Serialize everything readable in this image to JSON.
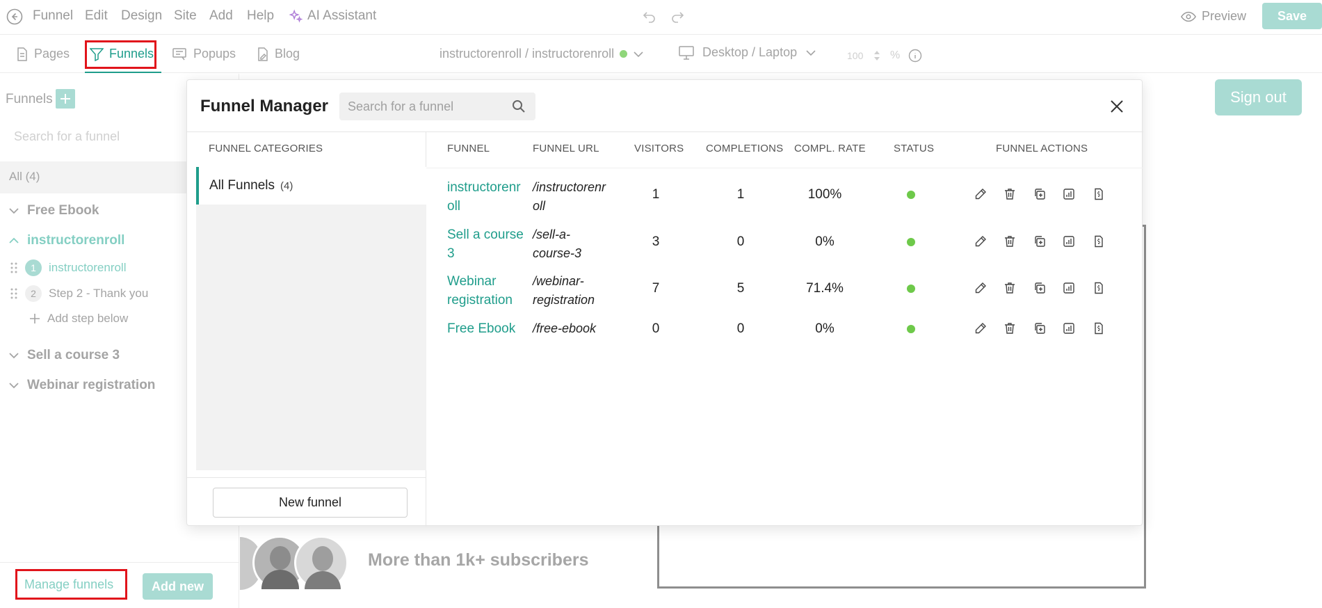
{
  "menu": {
    "items": [
      "Funnel",
      "Edit",
      "Design",
      "Site",
      "Add",
      "Help"
    ],
    "ai_assistant": "AI Assistant",
    "preview": "Preview",
    "save": "Save"
  },
  "tabs": {
    "pages": "Pages",
    "funnels": "Funnels",
    "popups": "Popups",
    "blog": "Blog"
  },
  "context": {
    "site_path": "instructorenroll / instructorenroll",
    "device": "Desktop / Laptop",
    "zoom_value": "100",
    "zoom_unit": "%"
  },
  "left_panel": {
    "title": "Funnels",
    "search_placeholder": "Search for a funnel",
    "all_filter": "All (4)",
    "groups": [
      {
        "name": "Free Ebook"
      },
      {
        "name": "instructorenroll"
      },
      {
        "name": "Sell a course 3"
      },
      {
        "name": "Webinar registration"
      }
    ],
    "steps": [
      {
        "num": "1",
        "label": "instructorenroll"
      },
      {
        "num": "2",
        "label": "Step 2 - Thank you"
      }
    ],
    "add_step": "Add step below",
    "manage_funnels": "Manage funnels",
    "add_new": "Add new"
  },
  "modal": {
    "title": "Funnel Manager",
    "search_placeholder": "Search for a funnel",
    "categories_header": "FUNNEL CATEGORIES",
    "category_all": "All Funnels",
    "category_count": "(4)",
    "new_funnel": "New funnel",
    "columns": {
      "funnel": "FUNNEL",
      "url": "FUNNEL URL",
      "visitors": "VISITORS",
      "completions": "COMPLETIONS",
      "rate": "COMPL. RATE",
      "status": "STATUS",
      "actions": "FUNNEL ACTIONS"
    },
    "rows": [
      {
        "name_l1": "instructorenr",
        "name_l2": "oll",
        "url_l1": "/instructorenr",
        "url_l2": "oll",
        "visitors": "1",
        "completions": "1",
        "rate": "100%"
      },
      {
        "name_l1": "Sell a course",
        "name_l2": "3",
        "url_l1": "/sell-a-",
        "url_l2": "course-3",
        "visitors": "3",
        "completions": "0",
        "rate": "0%"
      },
      {
        "name_l1": "Webinar",
        "name_l2": "registration",
        "url_l1": "/webinar-",
        "url_l2": "registration",
        "visitors": "7",
        "completions": "5",
        "rate": "71.4%"
      },
      {
        "name_l1": "Free Ebook",
        "name_l2": "",
        "url_l1": "/free-ebook",
        "url_l2": "",
        "visitors": "0",
        "completions": "0",
        "rate": "0%"
      }
    ]
  },
  "background": {
    "sign_out": "Sign out",
    "subscribers_text": "More than 1k+ subscribers"
  },
  "colors": {
    "accent": "#1f9d8b",
    "accent_faded": "#a9dbd3",
    "status_active": "#6ec94a",
    "highlight": "#e1141b"
  }
}
